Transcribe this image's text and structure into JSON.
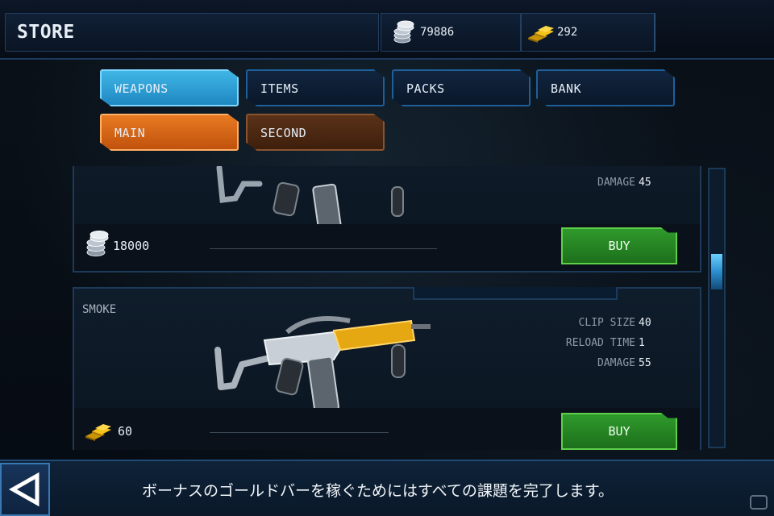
{
  "header": {
    "title": "STORE",
    "silver_amount": "79886",
    "gold_amount": "292"
  },
  "tabs": [
    {
      "label": "WEAPONS",
      "active": true
    },
    {
      "label": "ITEMS",
      "active": false
    },
    {
      "label": "PACKS",
      "active": false
    },
    {
      "label": "BANK",
      "active": false
    }
  ],
  "subtabs": [
    {
      "label": "MAIN",
      "active": true
    },
    {
      "label": "SECOND",
      "active": false
    }
  ],
  "items": [
    {
      "name": "",
      "stats": [
        {
          "label": "DAMAGE",
          "value": "45"
        }
      ],
      "price": "18000",
      "currency": "silver",
      "buy_label": "BUY"
    },
    {
      "name": "SMOKE",
      "stats": [
        {
          "label": "CLIP SIZE",
          "value": "40"
        },
        {
          "label": "RELOAD TIME",
          "value": "1"
        },
        {
          "label": "DAMAGE",
          "value": "55"
        }
      ],
      "price": "60",
      "currency": "gold",
      "buy_label": "BUY"
    }
  ],
  "scroll": {
    "position": 0.35
  },
  "footer": {
    "hint": "ボーナスのゴールドバーを稼ぐためにはすべての課題を完了します。"
  },
  "icons": {
    "silver": "silver-coins-icon",
    "gold": "gold-bars-icon",
    "back": "back-arrow-icon",
    "watermark": "gamer-logo-icon"
  },
  "colors": {
    "tab_active": "#2a9ad6",
    "subtab_active": "#d8661a",
    "buy_button": "#26852a"
  }
}
